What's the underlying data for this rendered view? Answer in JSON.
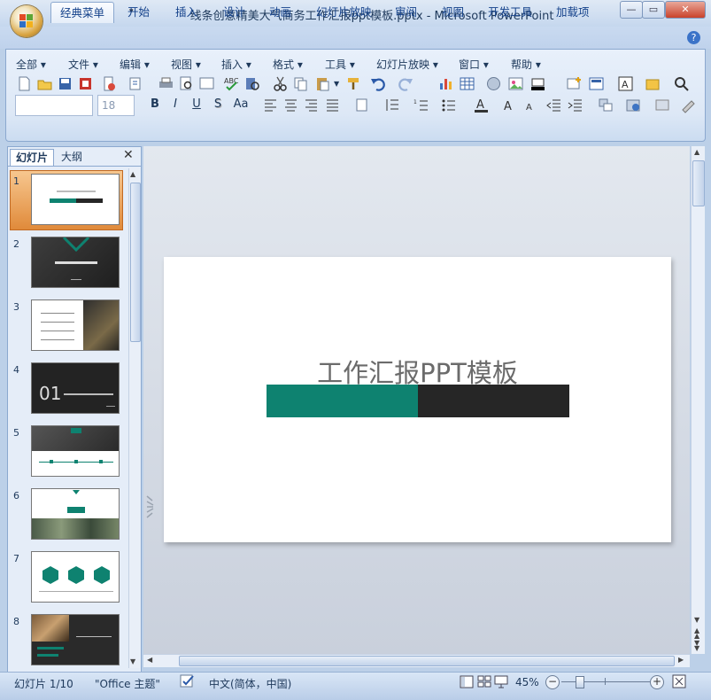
{
  "window": {
    "title": "线条创意精美大气商务工作汇报ppt模板.pptx - Microsoft PowerPoint",
    "buttons": [
      "—",
      "▭",
      "✕"
    ]
  },
  "ribbon_tabs": [
    "经典菜单",
    "开始",
    "插入",
    "设计",
    "动画",
    "幻灯片放映",
    "审阅",
    "视图",
    "开发工具",
    "加载项"
  ],
  "active_tab": "经典菜单",
  "classic_menu": [
    "全部 ▾",
    "文件 ▾",
    "编辑 ▾",
    "视图 ▾",
    "插入 ▾",
    "格式 ▾",
    "工具 ▾",
    "幻灯片放映 ▾",
    "窗口 ▾",
    "帮助 ▾"
  ],
  "font": {
    "name": "",
    "size": "18"
  },
  "format_buttons": [
    "B",
    "I",
    "U",
    "S",
    "Aa"
  ],
  "left_panel": {
    "tabs": [
      "幻灯片",
      "大纲"
    ],
    "close": "✕",
    "slides": [
      {
        "num": "1",
        "theme": "title"
      },
      {
        "num": "2",
        "theme": "dark"
      },
      {
        "num": "3",
        "theme": "list"
      },
      {
        "num": "4",
        "theme": "dark01"
      },
      {
        "num": "5",
        "theme": "timeline"
      },
      {
        "num": "6",
        "theme": "photos"
      },
      {
        "num": "7",
        "theme": "hex"
      },
      {
        "num": "8",
        "theme": "split"
      }
    ]
  },
  "slide": {
    "title": "工作汇报PPT模板",
    "bar_colors": [
      "#0e8270",
      "#262626"
    ]
  },
  "status": {
    "slide_info": "幻灯片 1/10",
    "theme": "\"Office 主题\"",
    "language": "中文(简体，中国)",
    "zoom": "45%",
    "zoom_minus": "−",
    "zoom_plus": "+"
  }
}
